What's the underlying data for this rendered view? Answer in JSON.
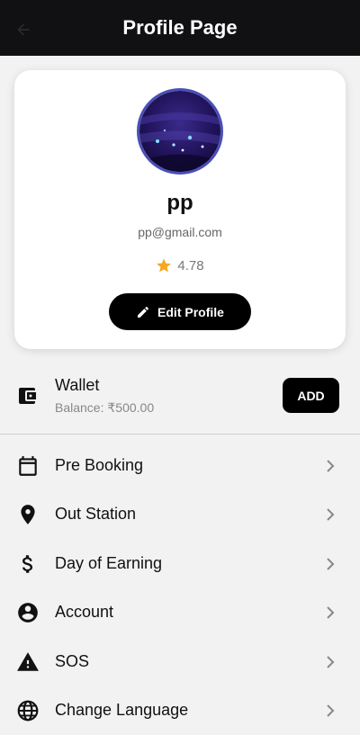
{
  "header": {
    "title": "Profile Page",
    "back_icon": "arrow-back-icon"
  },
  "profile": {
    "name": "pp",
    "email": "pp@gmail.com",
    "rating": "4.78",
    "edit_label": "Edit Profile",
    "colors": {
      "avatar_border": "#4a4fb8",
      "star": "#f5a623"
    }
  },
  "wallet": {
    "title": "Wallet",
    "balance": "Balance: ₹500.00",
    "add_label": "ADD"
  },
  "menu": {
    "items": [
      {
        "label": "Pre Booking",
        "icon": "calendar-icon"
      },
      {
        "label": "Out Station",
        "icon": "location-pin-icon"
      },
      {
        "label": "Day of Earning",
        "icon": "dollar-icon"
      },
      {
        "label": "Account",
        "icon": "account-circle-icon"
      },
      {
        "label": "SOS",
        "icon": "warning-icon"
      },
      {
        "label": "Change Language",
        "icon": "globe-icon"
      }
    ]
  }
}
